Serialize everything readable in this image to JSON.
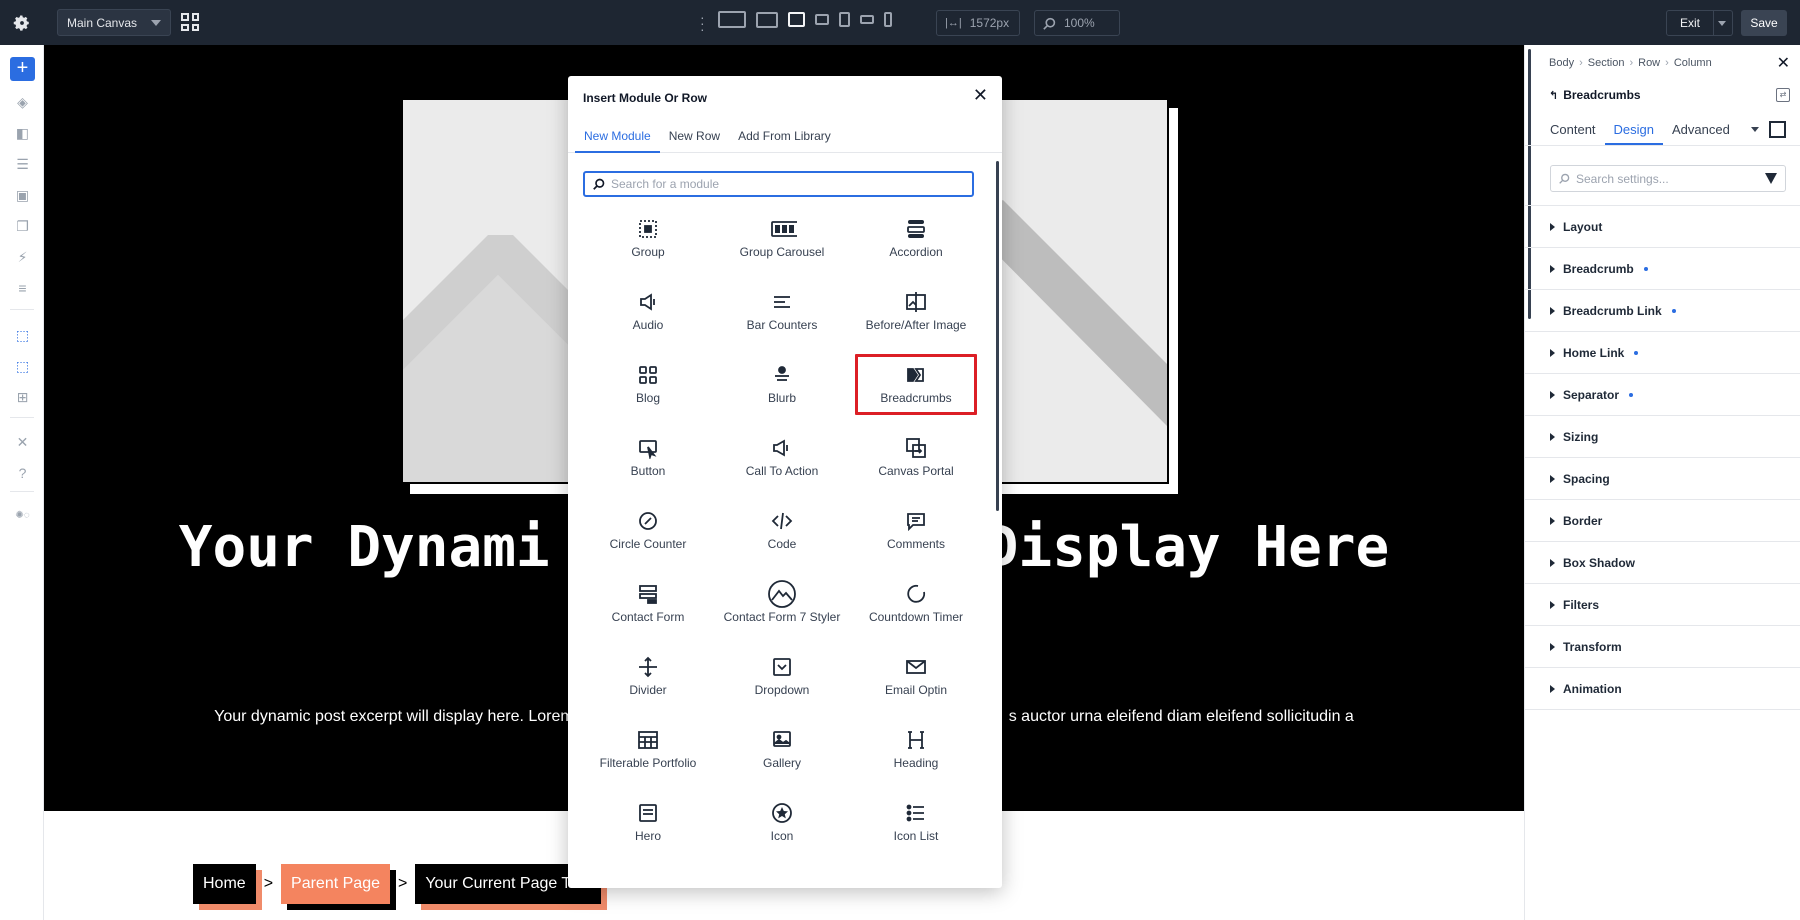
{
  "topbar": {
    "canvas_select": "Main Canvas",
    "width_value": "1572px",
    "zoom_value": "100%",
    "exit_label": "Exit",
    "save_label": "Save"
  },
  "canvas": {
    "hero_title_left": "Your Dynami",
    "hero_title_right": "Display Here",
    "hero_excerpt_left": "Your dynamic post excerpt will display here. Lorem",
    "hero_excerpt_right": "s auctor urna eleifend diam eleifend sollicitudin a",
    "breadcrumbs": {
      "home": "Home",
      "parent": "Parent Page",
      "current": "Your Current Page Title",
      "separator": ">"
    }
  },
  "modal": {
    "title": "Insert Module Or Row",
    "tabs": [
      {
        "label": "New Module",
        "active": true
      },
      {
        "label": "New Row",
        "active": false
      },
      {
        "label": "Add From Library",
        "active": false
      }
    ],
    "search_placeholder": "Search for a module",
    "modules": [
      {
        "label": "Group",
        "icon": "group-icon"
      },
      {
        "label": "Group Carousel",
        "icon": "group-carousel-icon"
      },
      {
        "label": "Accordion",
        "icon": "accordion-icon"
      },
      {
        "label": "Audio",
        "icon": "audio-icon"
      },
      {
        "label": "Bar Counters",
        "icon": "bar-counters-icon"
      },
      {
        "label": "Before/After Image",
        "icon": "before-after-image-icon"
      },
      {
        "label": "Blog",
        "icon": "blog-icon"
      },
      {
        "label": "Blurb",
        "icon": "blurb-icon"
      },
      {
        "label": "Breadcrumbs",
        "icon": "breadcrumbs-icon",
        "selected": true
      },
      {
        "label": "Button",
        "icon": "button-icon"
      },
      {
        "label": "Call To Action",
        "icon": "call-to-action-icon"
      },
      {
        "label": "Canvas Portal",
        "icon": "canvas-portal-icon"
      },
      {
        "label": "Circle Counter",
        "icon": "circle-counter-icon"
      },
      {
        "label": "Code",
        "icon": "code-icon"
      },
      {
        "label": "Comments",
        "icon": "comments-icon"
      },
      {
        "label": "Contact Form",
        "icon": "contact-form-icon"
      },
      {
        "label": "Contact Form 7 Styler",
        "icon": "contact-form-7-styler-icon"
      },
      {
        "label": "Countdown Timer",
        "icon": "countdown-timer-icon"
      },
      {
        "label": "Divider",
        "icon": "divider-icon"
      },
      {
        "label": "Dropdown",
        "icon": "dropdown-icon"
      },
      {
        "label": "Email Optin",
        "icon": "email-optin-icon"
      },
      {
        "label": "Filterable Portfolio",
        "icon": "filterable-portfolio-icon"
      },
      {
        "label": "Gallery",
        "icon": "gallery-icon"
      },
      {
        "label": "Heading",
        "icon": "heading-icon"
      },
      {
        "label": "Hero",
        "icon": "hero-icon"
      },
      {
        "label": "Icon",
        "icon": "icon-module-icon"
      },
      {
        "label": "Icon List",
        "icon": "icon-list-icon"
      }
    ]
  },
  "panel": {
    "breadcrumb": [
      "Body",
      "Section",
      "Row",
      "Column"
    ],
    "module_name": "Breadcrumbs",
    "tabs": [
      {
        "label": "Content",
        "active": false
      },
      {
        "label": "Design",
        "active": true
      },
      {
        "label": "Advanced",
        "active": false
      }
    ],
    "search_placeholder": "Search settings...",
    "groups": [
      {
        "label": "Layout",
        "modified": false
      },
      {
        "label": "Breadcrumb",
        "modified": true
      },
      {
        "label": "Breadcrumb Link",
        "modified": true
      },
      {
        "label": "Home Link",
        "modified": true
      },
      {
        "label": "Separator",
        "modified": true
      },
      {
        "label": "Sizing",
        "modified": false
      },
      {
        "label": "Spacing",
        "modified": false
      },
      {
        "label": "Border",
        "modified": false
      },
      {
        "label": "Box Shadow",
        "modified": false
      },
      {
        "label": "Filters",
        "modified": false
      },
      {
        "label": "Transform",
        "modified": false
      },
      {
        "label": "Animation",
        "modified": false
      }
    ]
  },
  "colors": {
    "accent": "#2b6de1",
    "topbar": "#1e2632",
    "selection": "#dc1f26",
    "crumb_orange": "#f4845f"
  }
}
